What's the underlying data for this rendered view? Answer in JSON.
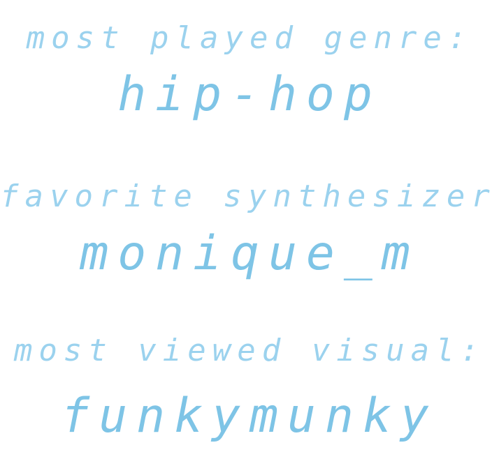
{
  "stats": [
    {
      "label": "most played genre:",
      "value": "hip-hop"
    },
    {
      "label": "favorite synthesizer:",
      "value": "monique_m"
    },
    {
      "label": "most viewed visual:",
      "value": "funkymunky"
    }
  ],
  "colors": {
    "text": "#88c8e8",
    "background": "#ffffff"
  }
}
